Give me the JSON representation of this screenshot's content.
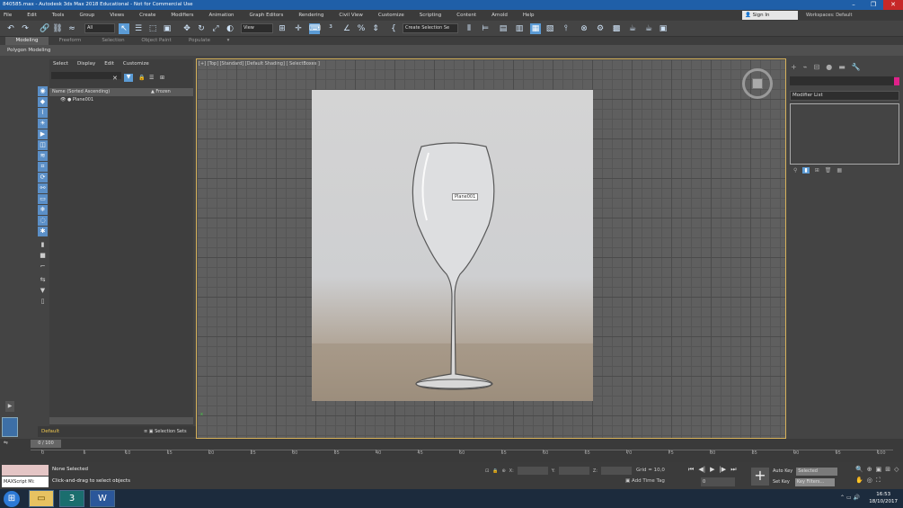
{
  "window": {
    "title": "840585.max - Autodesk 3ds Max 2018 Educational - Not for Commercial Use",
    "controls": [
      "–",
      "❐",
      "✕"
    ]
  },
  "menu": [
    "File",
    "Edit",
    "Tools",
    "Group",
    "Views",
    "Create",
    "Modifiers",
    "Animation",
    "Graph Editors",
    "Rendering",
    "Civil View",
    "Customize",
    "Scripting",
    "Content",
    "Arnold",
    "Help"
  ],
  "account": {
    "signin": "Sign In",
    "workspace": "Workspaces: Default"
  },
  "toolbar": {
    "filter": "All",
    "view": "View",
    "selection_set": "Create Selection Se"
  },
  "ribbon": {
    "tabs": [
      "Modeling",
      "Freeform",
      "Selection",
      "Object Paint",
      "Populate"
    ],
    "active": "Modeling",
    "panel": "Polygon Modeling"
  },
  "scene_explorer": {
    "menu": [
      "Select",
      "Display",
      "Edit",
      "Customize"
    ],
    "columns": {
      "name": "Name (Sorted Ascending)",
      "frozen": "▲ Frozen"
    },
    "rows": [
      {
        "name": "Plane001"
      }
    ],
    "layer": "Default",
    "selection_sets": "Selection Sets"
  },
  "viewport": {
    "label": "[+] [Top] [Standard] [Default Shading] [ SelectBoxes ]",
    "object_label": "Plane001",
    "axis": "x"
  },
  "command_panel": {
    "modifier_list": "Modifier List",
    "accent": "#e0218a"
  },
  "timeline": {
    "slider": "0 / 100",
    "ticks": [
      "0",
      "5",
      "10",
      "15",
      "20",
      "25",
      "30",
      "35",
      "40",
      "45",
      "50",
      "55",
      "60",
      "65",
      "70",
      "75",
      "80",
      "85",
      "90",
      "95",
      "100"
    ]
  },
  "status": {
    "message1": "None Selected",
    "message2": "Click-and-drag to select objects",
    "maxscript": "MAXScript Mi:",
    "x": "X:",
    "y": "Y:",
    "z": "Z:",
    "grid": "Grid = 10,0",
    "add_time_tag": "Add Time Tag",
    "frame": "0",
    "auto_key": "Auto Key",
    "auto_key_mode": "Selected",
    "set_key": "Set Key",
    "key_filters": "Key Filters..."
  },
  "taskbar": {
    "time": "16:53",
    "date": "18/10/2017"
  }
}
